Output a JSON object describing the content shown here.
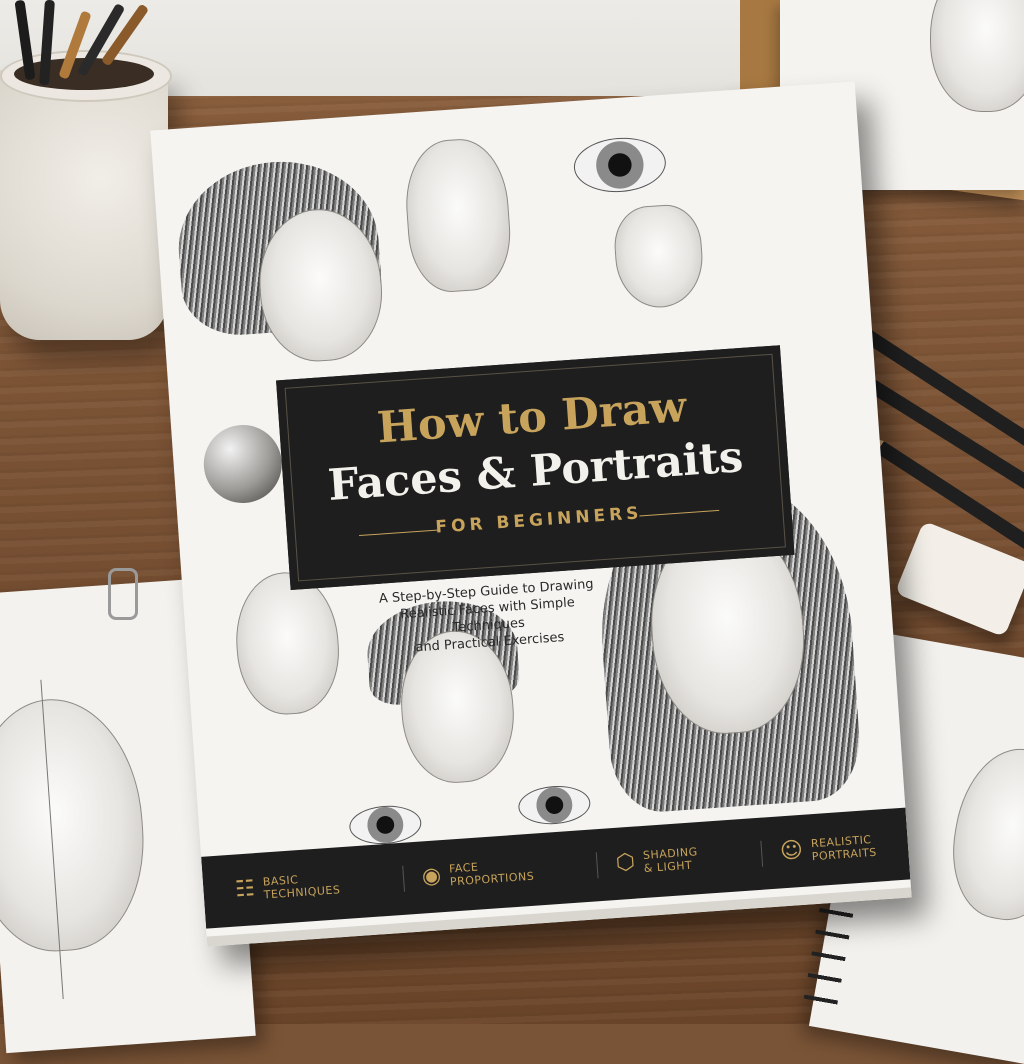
{
  "book": {
    "title_line1": "How to Draw",
    "title_line2": "Faces & Portraits",
    "title_line3": "FOR BEGINNERS",
    "subtitle_line1": "A Step-by-Step Guide to Drawing",
    "subtitle_line2": "Realistic Faces with Simple Techniques",
    "subtitle_line3": "and Practical Exercises",
    "features": [
      {
        "line1": "BASIC",
        "line2": "TECHNIQUES",
        "icon": "head-grid-icon"
      },
      {
        "line1": "FACE",
        "line2": "PROPORTIONS",
        "icon": "eye-icon"
      },
      {
        "line1": "SHADING",
        "line2": "& LIGHT",
        "icon": "cube-icon"
      },
      {
        "line1": "REALISTIC",
        "line2": "PORTRAITS",
        "icon": "portrait-icon"
      }
    ]
  },
  "colors": {
    "gold": "#c7a35c",
    "band": "#1e1e1e",
    "cover": "#f5f4f1",
    "desk": "#7a5234"
  }
}
